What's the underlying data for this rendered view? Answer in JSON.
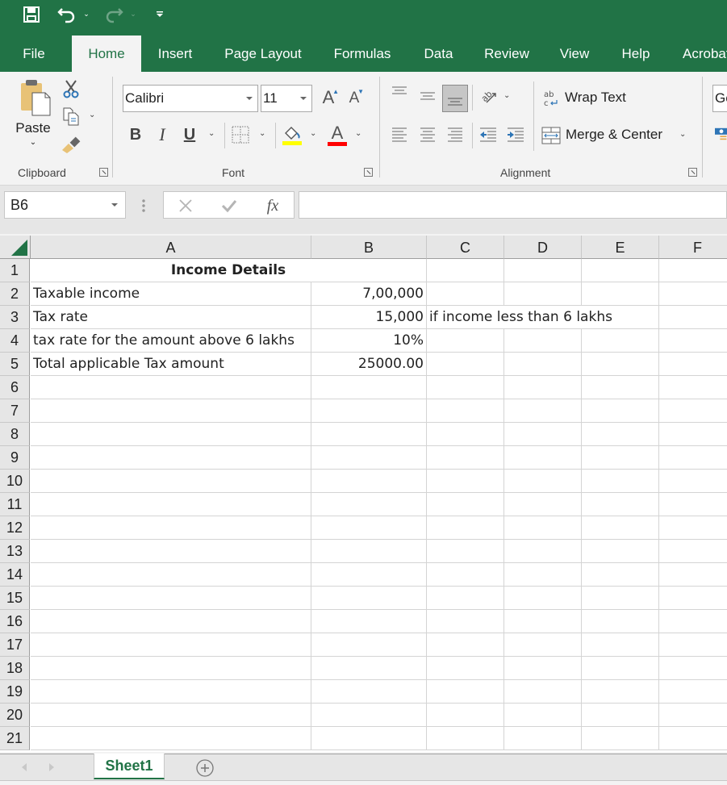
{
  "quick_access": {
    "save_icon": "save-icon",
    "undo_icon": "undo-icon",
    "redo_icon": "redo-icon",
    "customize_icon": "customize-qat-icon"
  },
  "tabs": [
    {
      "label": "File",
      "active": false
    },
    {
      "label": "Home",
      "active": true
    },
    {
      "label": "Insert",
      "active": false
    },
    {
      "label": "Page Layout",
      "active": false
    },
    {
      "label": "Formulas",
      "active": false
    },
    {
      "label": "Data",
      "active": false
    },
    {
      "label": "Review",
      "active": false
    },
    {
      "label": "View",
      "active": false
    },
    {
      "label": "Help",
      "active": false
    },
    {
      "label": "Acrobat",
      "active": false
    }
  ],
  "ribbon": {
    "clipboard": {
      "label": "Clipboard",
      "paste_label": "Paste"
    },
    "font": {
      "label": "Font",
      "font_name": "Calibri",
      "font_size": "11",
      "bold": "B",
      "italic": "I",
      "underline": "U",
      "highlight_color": "#ffff00",
      "font_color": "#ff0000",
      "grow_glyph": "A",
      "shrink_glyph": "A"
    },
    "alignment": {
      "label": "Alignment",
      "wrap_text": "Wrap Text",
      "merge_center": "Merge & Center"
    },
    "number": {
      "format_partial": "Ge"
    }
  },
  "formula_bar": {
    "name_box": "B6",
    "fx": "fx",
    "formula": ""
  },
  "columns": [
    "A",
    "B",
    "C",
    "D",
    "E",
    "F"
  ],
  "rows": [
    "1",
    "2",
    "3",
    "4",
    "5",
    "6",
    "7",
    "8",
    "9",
    "10",
    "11",
    "12",
    "13",
    "14",
    "15",
    "16",
    "17",
    "18",
    "19",
    "20",
    "21"
  ],
  "cells": {
    "A1": "Income Details",
    "A2": "Taxable income",
    "B2": "7,00,000",
    "A3": "Tax rate",
    "B3": "15,000",
    "C3": "if income less than 6 lakhs",
    "A4": "tax rate for the amount above 6 lakhs",
    "B4": "10%",
    "A5": "Total applicable Tax amount",
    "B5": "25000.00"
  },
  "sheets": {
    "active": "Sheet1",
    "add_icon": "add-sheet-icon"
  },
  "colors": {
    "brand": "#217346",
    "ribbon_bg": "#f3f3f3",
    "header_bg": "#e6e6e6"
  }
}
